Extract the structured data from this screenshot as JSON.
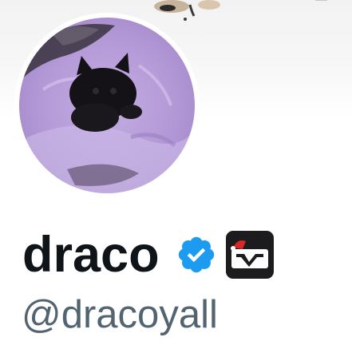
{
  "profile": {
    "display_name": "draco",
    "handle": "@dracoyall"
  },
  "icons": {
    "verified": "verified-check-icon",
    "affiliate": "affiliate-badge-icon"
  },
  "colors": {
    "name_text": "#0f1419",
    "handle_text": "#536471",
    "verified_blue": "#1d9bf0",
    "avatar_purple": "#b79ad9"
  }
}
